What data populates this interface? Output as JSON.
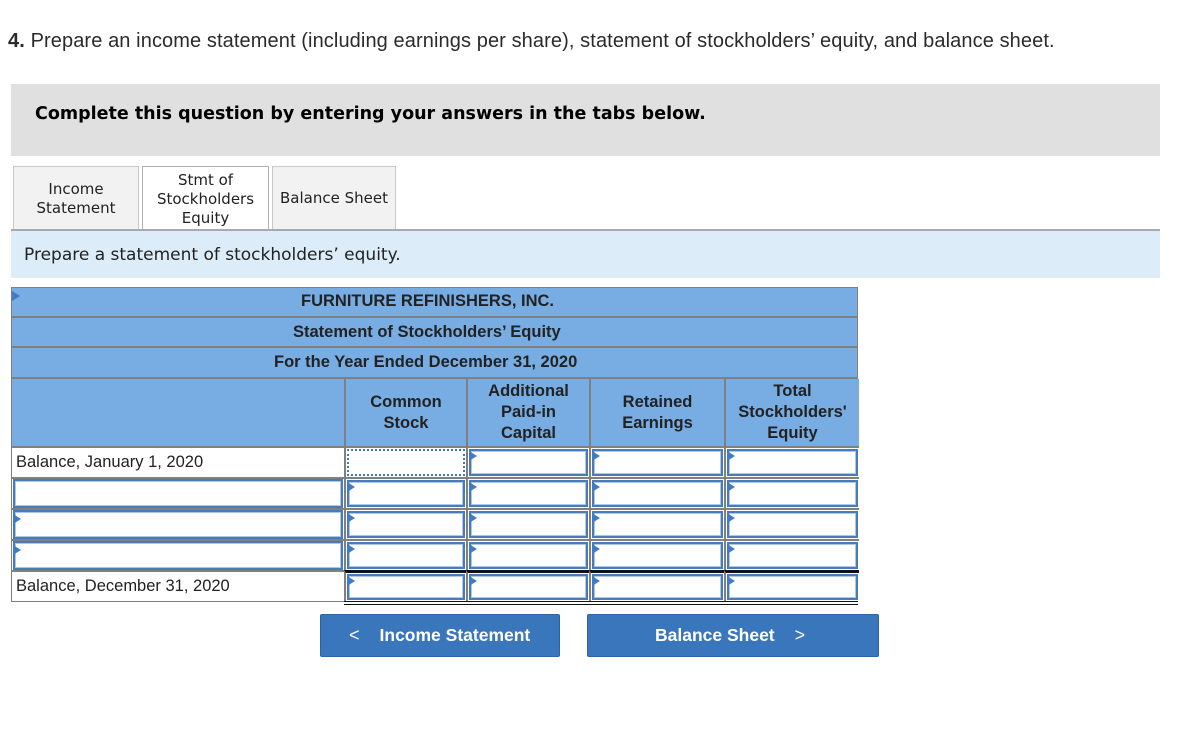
{
  "question": {
    "number": "4.",
    "text": "Prepare an income statement (including earnings per share), statement of stockholders’ equity, and balance sheet."
  },
  "instruction": "Complete this question by entering your answers in the tabs below.",
  "tabs": [
    {
      "label": "Income Statement",
      "active": false
    },
    {
      "label": "Stmt of Stockholders Equity",
      "active": true
    },
    {
      "label": "Balance Sheet",
      "active": false
    }
  ],
  "prompt": "Prepare a statement of stockholders’ equity.",
  "statement": {
    "company": "FURNITURE REFINISHERS, INC.",
    "title": "Statement of Stockholders’ Equity",
    "period": "For the Year Ended December 31, 2020",
    "columns": [
      "",
      "Common Stock",
      "Additional Paid-in Capital",
      "Retained Earnings",
      "Total Stockholders' Equity"
    ],
    "rows": [
      {
        "label": "Balance, January 1, 2020",
        "label_editable": false,
        "values": [
          "",
          "",
          "",
          ""
        ]
      },
      {
        "label": "",
        "label_editable": true,
        "values": [
          "",
          "",
          "",
          ""
        ]
      },
      {
        "label": "",
        "label_editable": true,
        "values": [
          "",
          "",
          "",
          ""
        ]
      },
      {
        "label": "",
        "label_editable": true,
        "values": [
          "",
          "",
          "",
          ""
        ]
      },
      {
        "label": "Balance, December 31, 2020",
        "label_editable": false,
        "values": [
          "",
          "",
          "",
          ""
        ]
      }
    ]
  },
  "nav": {
    "prev_label": "Income Statement",
    "next_label": "Balance Sheet",
    "prev_icon": "chevron-left-icon",
    "next_icon": "chevron-right-icon"
  },
  "colors": {
    "header_blue": "#78ade3",
    "prompt_bg": "#dcecf8",
    "instruction_bg": "#e0e0e0",
    "button_blue": "#3a76bb",
    "input_border": "#4a7ab8"
  }
}
